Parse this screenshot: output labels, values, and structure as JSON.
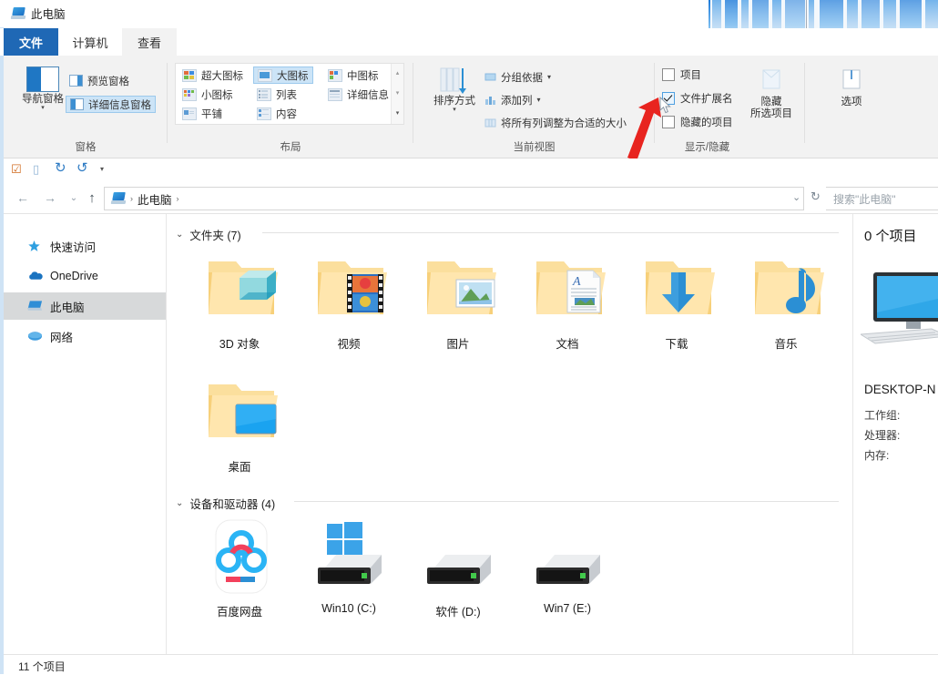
{
  "window": {
    "title": "此电脑",
    "title_icon": "this-pc-icon"
  },
  "tabs": [
    {
      "label": "文件",
      "state": "file-menu"
    },
    {
      "label": "计算机",
      "state": "inactive"
    },
    {
      "label": "查看",
      "state": "active"
    }
  ],
  "ribbon": {
    "groups": [
      {
        "name": "窗格",
        "label": "窗格",
        "big_button": {
          "label": "导航窗格",
          "icon": "navigation-pane-icon",
          "has_dropdown": true
        },
        "items": [
          {
            "label": "预览窗格",
            "icon": "preview-pane-icon",
            "selected": false
          },
          {
            "label": "详细信息窗格",
            "icon": "details-pane-icon",
            "selected": true
          }
        ]
      },
      {
        "name": "布局",
        "label": "布局",
        "items": [
          {
            "label": "超大图标",
            "icon": "extra-large-icons-icon",
            "selected": false
          },
          {
            "label": "大图标",
            "icon": "large-icons-icon",
            "selected": true
          },
          {
            "label": "中图标",
            "icon": "medium-icons-icon",
            "selected": false
          },
          {
            "label": "小图标",
            "icon": "small-icons-icon",
            "selected": false
          },
          {
            "label": "列表",
            "icon": "list-view-icon",
            "selected": false
          },
          {
            "label": "详细信息",
            "icon": "details-view-icon",
            "selected": false
          },
          {
            "label": "平铺",
            "icon": "tiles-view-icon",
            "selected": false
          },
          {
            "label": "内容",
            "icon": "content-view-icon",
            "selected": false
          }
        ],
        "scroll_up": "▴",
        "scroll_down": "▾",
        "scroll_more": "▾"
      },
      {
        "name": "当前视图",
        "label": "当前视图",
        "big_button": {
          "label": "排序方式",
          "icon": "sort-by-icon",
          "has_dropdown": true
        },
        "items": [
          {
            "label": "分组依据",
            "icon": "group-by-icon",
            "has_dropdown": true
          },
          {
            "label": "添加列",
            "icon": "add-columns-icon",
            "has_dropdown": true
          },
          {
            "label": "将所有列调整为合适的大小",
            "icon": "size-columns-icon",
            "has_dropdown": false
          }
        ]
      },
      {
        "name": "显示/隐藏",
        "label": "显示/隐藏",
        "checkboxes": [
          {
            "label": "项目",
            "checked": false
          },
          {
            "label": "文件扩展名",
            "checked": true,
            "highlighted": true
          },
          {
            "label": "隐藏的项目",
            "checked": false
          }
        ],
        "big_button": {
          "label_line1": "隐藏",
          "label_line2": "所选项目",
          "icon": "hide-selected-items-icon"
        }
      },
      {
        "name": "选项",
        "label": "",
        "big_button": {
          "label": "选项",
          "icon": "options-icon"
        }
      }
    ]
  },
  "quick_access_toolbar": [
    {
      "name": "properties-icon",
      "glyph": "☑"
    },
    {
      "name": "new-folder-icon",
      "glyph": "▯"
    },
    {
      "name": "redo-icon",
      "glyph": "↻"
    },
    {
      "name": "undo-icon",
      "glyph": "↺"
    },
    {
      "name": "customize-qat-icon",
      "glyph": "▾"
    }
  ],
  "address_bar": {
    "back": "←",
    "forward": "→",
    "recent": "⌄",
    "up": "↑",
    "breadcrumb_icon": "this-pc-icon",
    "breadcrumb": [
      "此电脑"
    ],
    "separator": "›",
    "dropdown": "⌄",
    "refresh": "↻",
    "search_placeholder": "搜索\"此电脑\""
  },
  "sidebar": {
    "items": [
      {
        "label": "快速访问",
        "icon": "star-icon",
        "selected": false
      },
      {
        "label": "OneDrive",
        "icon": "onedrive-cloud-icon",
        "selected": false
      },
      {
        "label": "此电脑",
        "icon": "this-pc-icon",
        "selected": true
      },
      {
        "label": "网络",
        "icon": "network-icon",
        "selected": false
      }
    ]
  },
  "content": {
    "groups": [
      {
        "title": "文件夹 (7)",
        "caret": "⌄",
        "items": [
          {
            "label": "3D 对象",
            "icon": "folder-3d-objects-icon"
          },
          {
            "label": "视频",
            "icon": "folder-videos-icon"
          },
          {
            "label": "图片",
            "icon": "folder-pictures-icon"
          },
          {
            "label": "文档",
            "icon": "folder-documents-icon"
          },
          {
            "label": "下载",
            "icon": "folder-downloads-icon"
          },
          {
            "label": "音乐",
            "icon": "folder-music-icon"
          },
          {
            "label": "桌面",
            "icon": "folder-desktop-icon"
          }
        ]
      },
      {
        "title": "设备和驱动器 (4)",
        "caret": "⌄",
        "items": [
          {
            "label": "百度网盘",
            "icon": "baidu-netdisk-icon"
          },
          {
            "label": "Win10 (C:)",
            "icon": "system-drive-icon"
          },
          {
            "label": "软件 (D:)",
            "icon": "drive-icon"
          },
          {
            "label": "Win7 (E:)",
            "icon": "drive-icon"
          }
        ]
      }
    ]
  },
  "details_pane": {
    "count": "0 个项目",
    "computer_icon": "desktop-computer-icon",
    "computer_name": "DESKTOP-N",
    "fields": [
      {
        "label": "工作组:"
      },
      {
        "label": "处理器:"
      },
      {
        "label": "内存:"
      }
    ]
  },
  "status_bar": {
    "item_count": "11 个项目"
  },
  "annotation": {
    "arrow_color": "#e8241f",
    "points_to": "文件扩展名"
  },
  "colors": {
    "accent": "#1f68b5",
    "ribbon_bg": "#f2f2f2",
    "selection": "#cce4f7",
    "sidebar_selection": "#d7d9da",
    "folder_yellow": "#f8d489",
    "arrow_red": "#e8241f"
  }
}
